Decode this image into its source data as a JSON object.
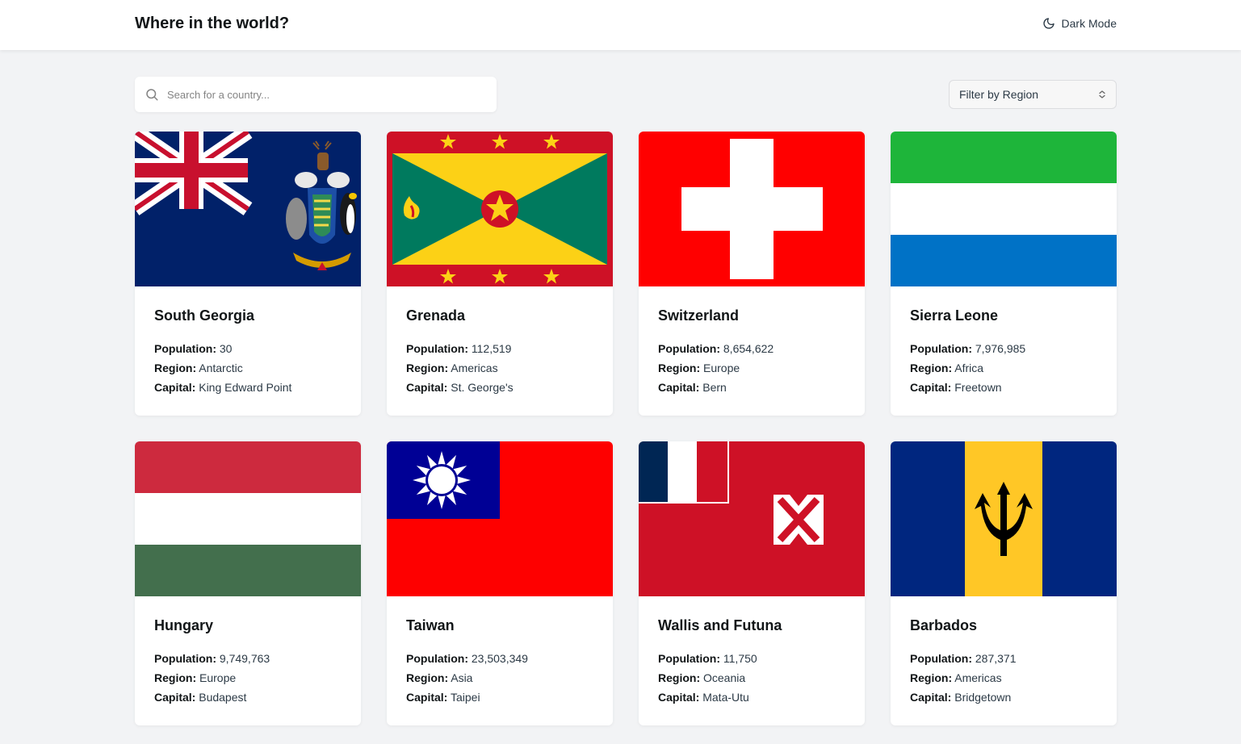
{
  "header": {
    "title": "Where in the world?",
    "dark_mode_label": "Dark Mode"
  },
  "search": {
    "placeholder": "Search for a country..."
  },
  "filter": {
    "label": "Filter by Region"
  },
  "labels": {
    "population": "Population:",
    "region": "Region:",
    "capital": "Capital:"
  },
  "countries": [
    {
      "name": "South Georgia",
      "population": "30",
      "region": "Antarctic",
      "capital": "King Edward Point"
    },
    {
      "name": "Grenada",
      "population": "112,519",
      "region": "Americas",
      "capital": "St. George's"
    },
    {
      "name": "Switzerland",
      "population": "8,654,622",
      "region": "Europe",
      "capital": "Bern"
    },
    {
      "name": "Sierra Leone",
      "population": "7,976,985",
      "region": "Africa",
      "capital": "Freetown"
    },
    {
      "name": "Hungary",
      "population": "9,749,763",
      "region": "Europe",
      "capital": "Budapest"
    },
    {
      "name": "Taiwan",
      "population": "23,503,349",
      "region": "Asia",
      "capital": "Taipei"
    },
    {
      "name": "Wallis and Futuna",
      "population": "11,750",
      "region": "Oceania",
      "capital": "Mata-Utu"
    },
    {
      "name": "Barbados",
      "population": "287,371",
      "region": "Americas",
      "capital": "Bridgetown"
    }
  ]
}
